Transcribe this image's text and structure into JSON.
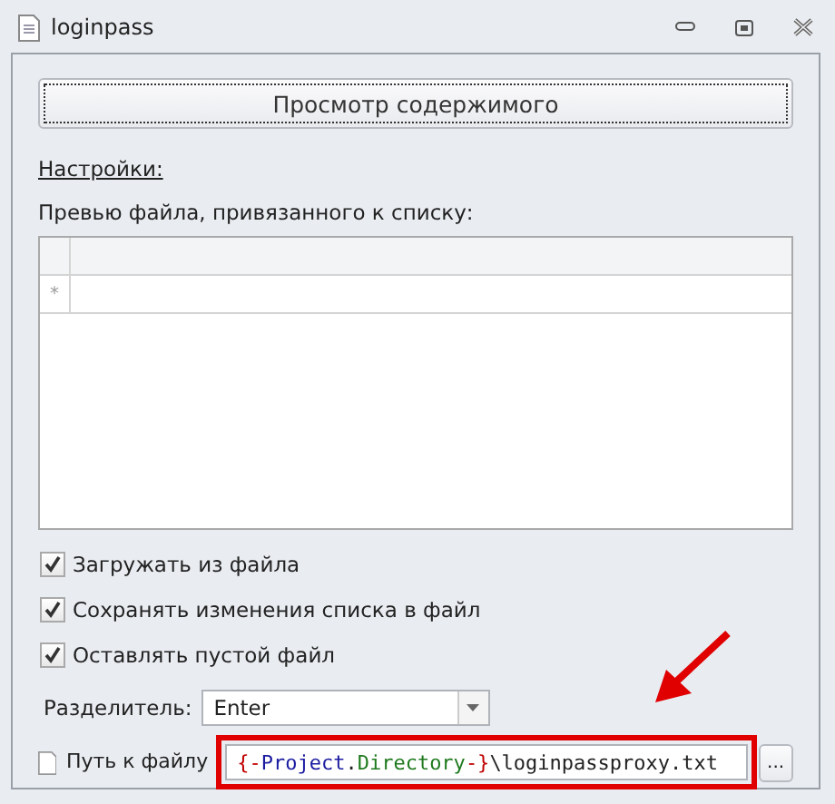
{
  "window": {
    "title": "loginpass"
  },
  "view_button": "Просмотр содержимого",
  "settings_link": "Настройки:",
  "preview_label": "Превью файла, привязанного к списку:",
  "grid": {
    "new_row_marker": "*"
  },
  "checkboxes": [
    {
      "label": "Загружать из файла",
      "checked": true
    },
    {
      "label": "Сохранять изменения списка в файл",
      "checked": true
    },
    {
      "label": "Оставлять пустой файл",
      "checked": true
    }
  ],
  "separator": {
    "label": "Разделитель:",
    "value": "Enter"
  },
  "file_path": {
    "label": "Путь к файлу",
    "segments": [
      {
        "text": "{-",
        "kind": "brace"
      },
      {
        "text": "Project",
        "kind": "object"
      },
      {
        "text": ".",
        "kind": "plain"
      },
      {
        "text": "Directory",
        "kind": "member"
      },
      {
        "text": "-}",
        "kind": "brace"
      },
      {
        "text": "\\loginpassproxy.txt",
        "kind": "plain"
      }
    ],
    "browse_button": "..."
  },
  "annotation": {
    "highlight": true,
    "arrow": true
  }
}
